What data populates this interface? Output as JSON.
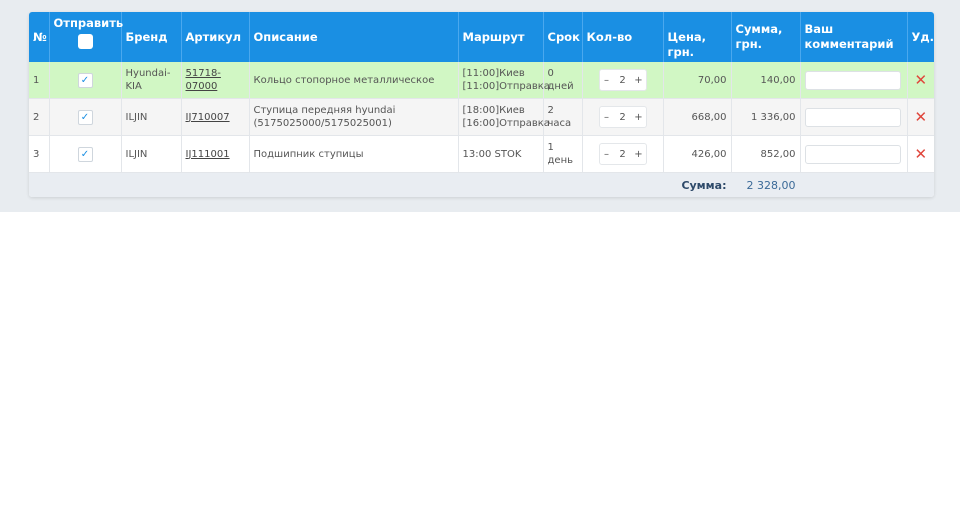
{
  "header": {
    "num": "№",
    "send": "Отправить",
    "brand": "Бренд",
    "article": "Артикул",
    "description": "Описание",
    "route": "Маршрут",
    "term": "Срок",
    "qty": "Кол-во",
    "price": "Цена, грн.",
    "sum": "Сумма, грн.",
    "comment": "Ваш комментарий",
    "del": "Уд."
  },
  "rows": [
    {
      "num": "1",
      "checked": "✓",
      "brand": "Hyundai-KIA",
      "article": "51718-07000",
      "description": "Кольцо стопорное металлическое",
      "route_1": "[11:00]Киев",
      "route_2": "[11:00]Отправка",
      "term": "0 дней",
      "qty": "2",
      "price": "70,00",
      "sum": "140,00",
      "del": "✕"
    },
    {
      "num": "2",
      "checked": "✓",
      "brand": "ILJIN",
      "article": "IJ710007",
      "description": "Ступица передняя hyundai (5175025000/5175025001)",
      "route_1": "[18:00]Киев",
      "route_2": "[16:00]Отправка",
      "term": "2 часа",
      "qty": "2",
      "price": "668,00",
      "sum": "1 336,00",
      "del": "✕"
    },
    {
      "num": "3",
      "checked": "✓",
      "brand": "ILJIN",
      "article": "IJ111001",
      "description": "Подшипник ступицы",
      "route_1": "13:00 STOK",
      "route_2": "",
      "term": "1 день",
      "qty": "2",
      "price": "426,00",
      "sum": "852,00",
      "del": "✕"
    }
  ],
  "qty_controls": {
    "minus": "–",
    "plus": "+"
  },
  "footer": {
    "sum_label": "Сумма:",
    "sum_value": "2 328,00"
  },
  "colors": {
    "header_bg": "#1a8fe3",
    "row_selected": "#d1f7c4",
    "delete": "#e0463c"
  }
}
